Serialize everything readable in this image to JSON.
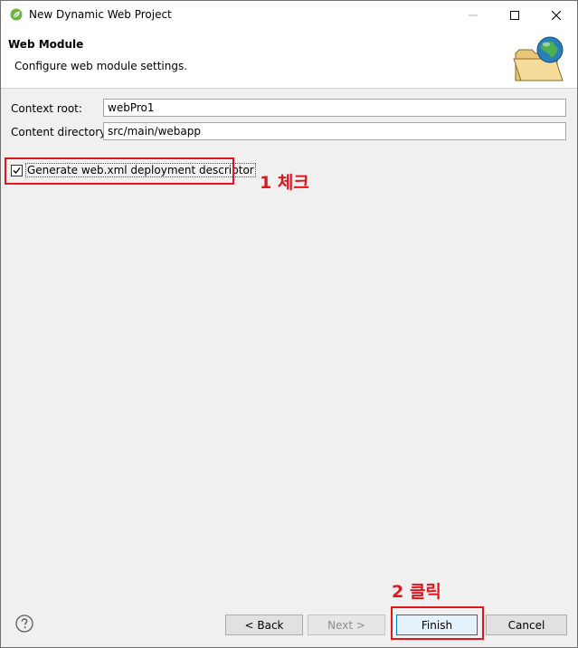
{
  "window": {
    "title": "New Dynamic Web Project",
    "icons": [
      "spring-leaf-icon",
      "minimize-icon",
      "maximize-icon",
      "close-icon"
    ]
  },
  "header": {
    "title": "Web Module",
    "description": "Configure web module settings.",
    "icon": "web-folder-globe-icon"
  },
  "form": {
    "context_root_label": "Context root:",
    "context_root_value": "webPro1",
    "content_directory_label": "Content directory:",
    "content_directory_value": "src/main/webapp",
    "generate_checkbox_label": "Generate web.xml deployment descriptor",
    "generate_checked": true
  },
  "annotations": {
    "step1": "1 체크",
    "step2": "2 클릭",
    "color": "#e4141b"
  },
  "footer": {
    "help_icon": "help-question-icon",
    "back_label": "< Back",
    "next_label": "Next >",
    "finish_label": "Finish",
    "cancel_label": "Cancel"
  }
}
